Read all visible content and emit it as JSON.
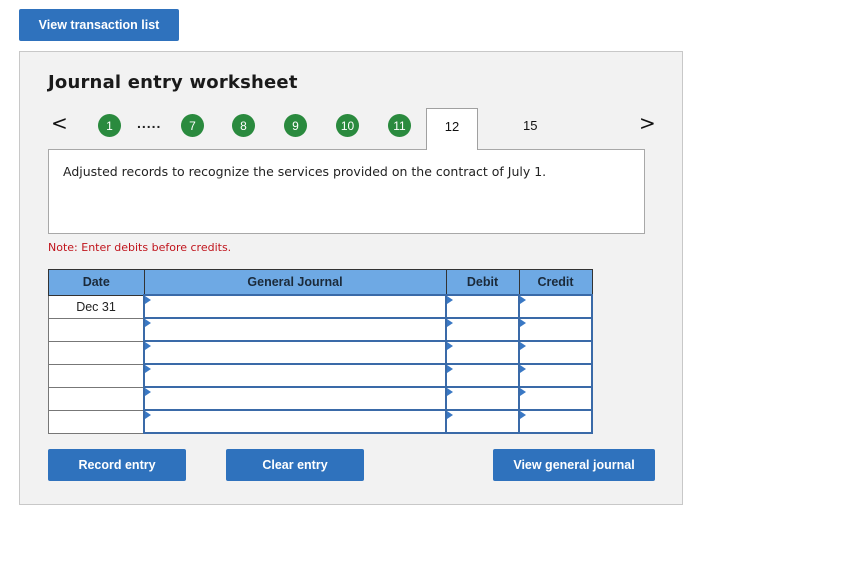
{
  "top_button": {
    "label": "View transaction list"
  },
  "worksheet": {
    "title": "Journal entry worksheet",
    "nav": {
      "prev_icon": "chevron-left-icon",
      "next_icon": "chevron-right-icon",
      "prev_glyph": "<",
      "next_glyph": ">",
      "completed_steps": [
        "1",
        "7",
        "8",
        "9",
        "10",
        "11"
      ],
      "ellipsis": ".....",
      "active_tab": "12",
      "other_tab": "15",
      "completed_color": "#2a8a3e"
    },
    "description": "Adjusted records to recognize the services provided on the contract of July 1.",
    "note": "Note: Enter debits before credits.",
    "table": {
      "headers": {
        "date": "Date",
        "general_journal": "General Journal",
        "debit": "Debit",
        "credit": "Credit"
      },
      "rows": [
        {
          "date": "Dec 31",
          "account": "",
          "debit": "",
          "credit": ""
        },
        {
          "date": "",
          "account": "",
          "debit": "",
          "credit": ""
        },
        {
          "date": "",
          "account": "",
          "debit": "",
          "credit": ""
        },
        {
          "date": "",
          "account": "",
          "debit": "",
          "credit": ""
        },
        {
          "date": "",
          "account": "",
          "debit": "",
          "credit": ""
        },
        {
          "date": "",
          "account": "",
          "debit": "",
          "credit": ""
        }
      ]
    },
    "buttons": {
      "record": "Record entry",
      "clear": "Clear entry",
      "view_journal": "View general journal"
    }
  },
  "colors": {
    "button_blue": "#2f72bd",
    "header_blue": "#6ea9e4",
    "note_red": "#c0141c"
  }
}
